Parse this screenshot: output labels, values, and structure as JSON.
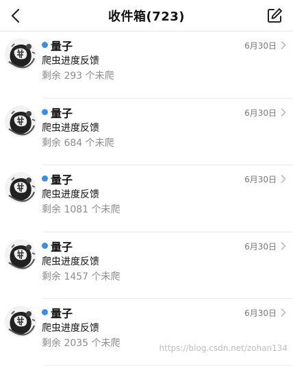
{
  "header": {
    "title": "收件箱(723)",
    "back_icon": "chevron-left-icon",
    "compose_icon": "compose-edit-icon"
  },
  "colors": {
    "unread_dot": "#3a8ee6",
    "preview_text": "#8c8c8c",
    "date_text": "#777777"
  },
  "messages": [
    {
      "sender": "量子",
      "subject": "爬虫进度反馈",
      "preview": "剩余 293 个未爬",
      "date": "6月30日",
      "unread": true
    },
    {
      "sender": "量子",
      "subject": "爬虫进度反馈",
      "preview": "剩余 684 个未爬",
      "date": "6月30日",
      "unread": true
    },
    {
      "sender": "量子",
      "subject": "爬虫进度反馈",
      "preview": "剩余 1081 个未爬",
      "date": "6月30日",
      "unread": true
    },
    {
      "sender": "量子",
      "subject": "爬虫进度反馈",
      "preview": "剩余 1457 个未爬",
      "date": "6月30日",
      "unread": true
    },
    {
      "sender": "量子",
      "subject": "爬虫进度反馈",
      "preview": "剩余 2035 个未爬",
      "date": "6月30日",
      "unread": true
    }
  ],
  "watermark": "https://blog.csdn.net/zohan134"
}
